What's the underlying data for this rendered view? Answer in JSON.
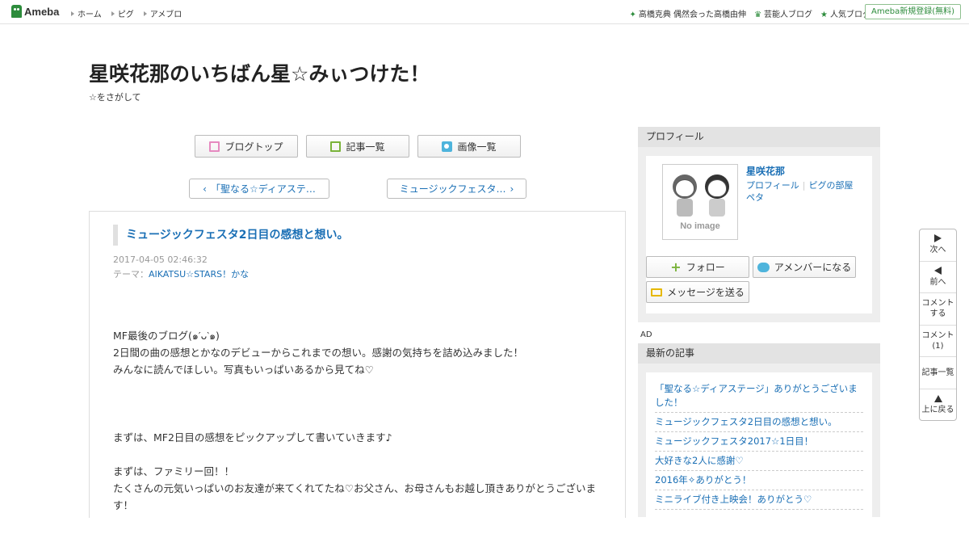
{
  "topbar": {
    "logo_text": "Ameba",
    "nav": [
      "ホーム",
      "ピグ",
      "アメブロ"
    ],
    "right_links": [
      {
        "icon": "sparkle-icon",
        "label": "高橋克典 偶然会った高橋由伸"
      },
      {
        "icon": "crown-icon",
        "label": "芸能人ブログ"
      },
      {
        "icon": "star-icon",
        "label": "人気ブログ"
      }
    ],
    "register_label": "Ameba新規登録(無料)"
  },
  "blog": {
    "title": "星咲花那のいちばん星☆みぃつけた！",
    "description": "☆をさがして"
  },
  "nav_buttons": {
    "blog_top": "ブログトップ",
    "entry_list": "記事一覧",
    "image_list": "画像一覧"
  },
  "pager": {
    "prev": "「聖なる☆ディアステ…",
    "next": "ミュージックフェスタ…"
  },
  "entry": {
    "title": "ミュージックフェスタ2日目の感想と想い。",
    "date": "2017-04-05 02:46:32",
    "theme_label": "テーマ：",
    "theme": "AIKATSU☆STARS！かな",
    "paragraphs": [
      "MF最後のブログ(๑′ᴗ‵๑)",
      "2日間の曲の感想とかなのデビューからこれまでの想い。感謝の気持ちを詰め込みました！",
      "みんなに読んでほしい。写真もいっぱいあるから見てね♡",
      "まずは、MF2日目の感想をピックアップして書いていきます♪",
      "まずは、ファミリー回！！",
      "たくさんの元気いっぱいのお友達が来てくれてたね♡お父さん、お母さんもお越し頂きありがとうございます！"
    ]
  },
  "sidebar": {
    "profile_heading": "プロフィール",
    "avatar_text": "No image",
    "name": "星咲花那",
    "links": [
      "プロフィール",
      "ピグの部屋",
      "ペタ"
    ],
    "follow_label": "フォロー",
    "amember_label": "アメンバーになる",
    "message_label": "メッセージを送る",
    "ad_label": "AD",
    "latest_heading": "最新の記事",
    "latest_items": [
      "「聖なる☆ディアステージ」ありがとうございました！",
      "ミュージックフェスタ2日目の感想と想い。",
      "ミュージックフェスタ2017☆1日目！",
      "大好きな2人に感謝♡",
      "2016年✧ありがとう！",
      "ミニライブ付き上映会！ありがとう♡"
    ]
  },
  "floatnav": {
    "next": "次へ",
    "prev": "前へ",
    "comment_line1": "コメント",
    "comment_line2": "する",
    "comments_line1": "コメント",
    "comments_line2": "(1)",
    "entry_list": "記事一覧",
    "to_top": "上に戻る"
  },
  "colors": {
    "link": "#1a6fb5",
    "brand_green": "#2d8c3c"
  }
}
